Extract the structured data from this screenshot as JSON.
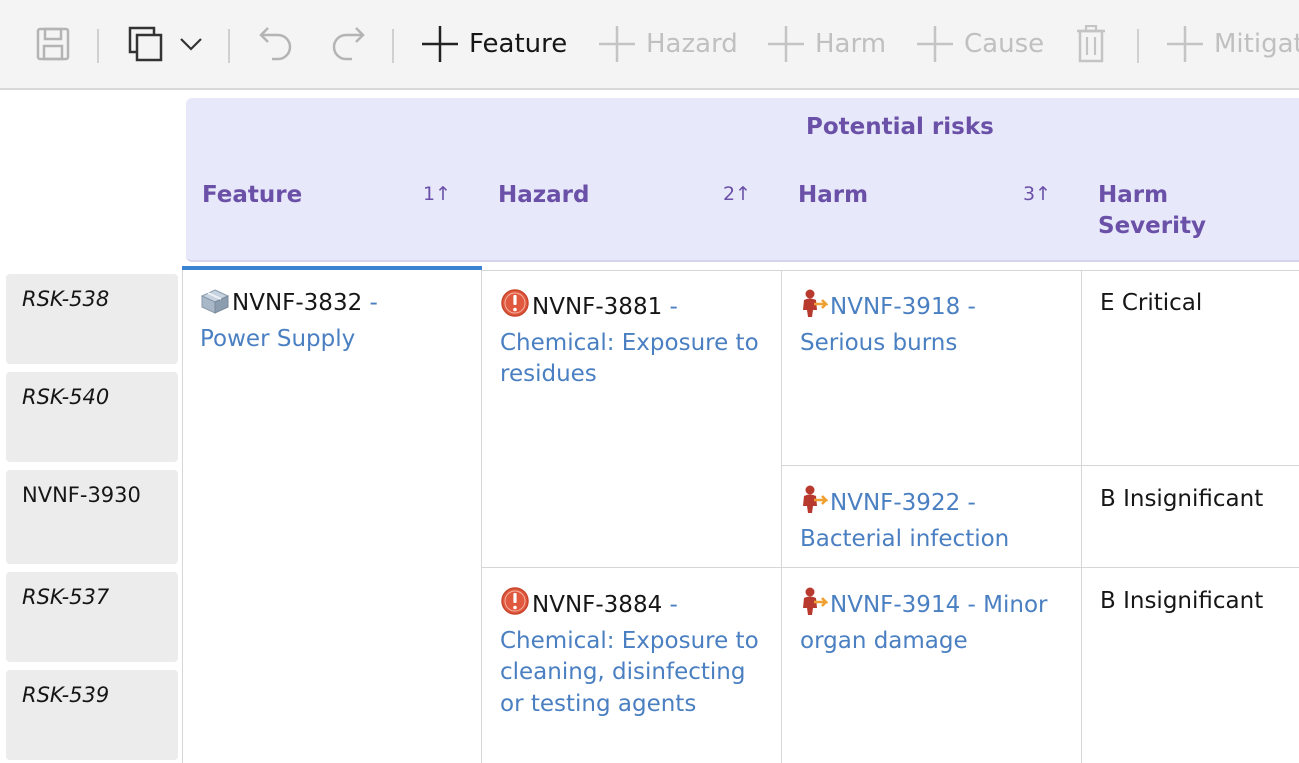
{
  "toolbar": {
    "feature_label": "Feature",
    "hazard_label": "Hazard",
    "harm_label": "Harm",
    "cause_label": "Cause",
    "mitigation_label": "Mitigat"
  },
  "row_headers": [
    "RSK-538",
    "RSK-540",
    "NVNF-3930",
    "RSK-537",
    "RSK-539"
  ],
  "header": {
    "group_title": "Potential risks",
    "columns": [
      {
        "label": "Feature",
        "sort": "1↑"
      },
      {
        "label": "Hazard",
        "sort": "2↑"
      },
      {
        "label": "Harm",
        "sort": "3↑"
      },
      {
        "label": "Harm Severity"
      }
    ]
  },
  "feature": {
    "id": "NVNF-3832",
    "sep": " -",
    "name": "Power Supply"
  },
  "hazards": [
    {
      "id": "NVNF-3881",
      "sep": " -",
      "line1": "Chemical: Exposure to",
      "line2": "residues"
    },
    {
      "id": "NVNF-3884",
      "sep": " -",
      "line1": "Chemical: Exposure to",
      "line2": "cleaning, disinfecting",
      "line3": "or testing agents"
    }
  ],
  "harms": [
    {
      "id": "NVNF-3918",
      "sep": " -",
      "line1": "Serious burns",
      "severity": "E Critical"
    },
    {
      "id": "NVNF-3922",
      "sep": " -",
      "line1": "Bacterial infection",
      "severity": "B Insignificant"
    },
    {
      "id": "NVNF-3914",
      "sep": " - Minor",
      "line1": "organ damage",
      "severity": "B Insignificant"
    }
  ],
  "colors": {
    "header_bg": "#e8e8fb",
    "header_text": "#6a50a7",
    "link": "#4a7fc1",
    "selection": "#3a85d1",
    "hazard_icon": "#e0593e",
    "harm_icon": "#b83a2e"
  },
  "icons": {
    "save": "save-icon",
    "copy": "copy-icon",
    "undo": "undo-icon",
    "redo": "redo-icon",
    "add": "plus-icon",
    "delete": "trash-icon",
    "feature": "feature-cube-icon",
    "hazard": "hazard-warning-icon",
    "harm": "harm-person-icon"
  }
}
